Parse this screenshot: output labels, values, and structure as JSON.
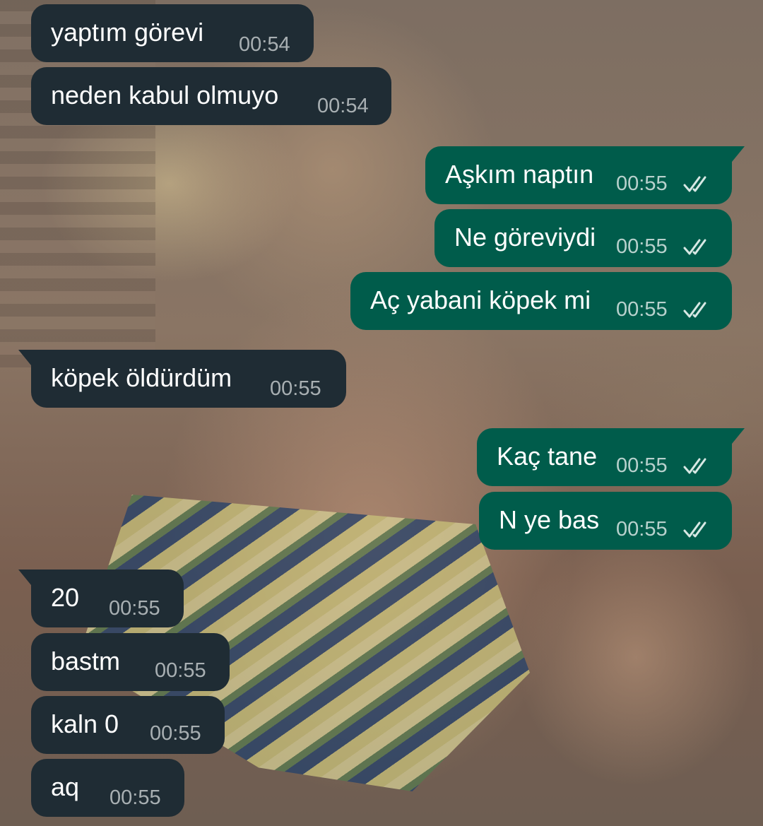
{
  "chat": {
    "messages": [
      {
        "direction": "incoming",
        "text": "yaptım görevi",
        "time": "00:54"
      },
      {
        "direction": "incoming",
        "text": "neden kabul olmuyo",
        "time": "00:54"
      },
      {
        "direction": "outgoing",
        "text": "Aşkım naptın",
        "time": "00:55",
        "status": "read-double-check"
      },
      {
        "direction": "outgoing",
        "text": "Ne göreviydi",
        "time": "00:55",
        "status": "read-double-check"
      },
      {
        "direction": "outgoing",
        "text": "Aç yabani köpek mi",
        "time": "00:55",
        "status": "read-double-check"
      },
      {
        "direction": "incoming",
        "text": "köpek öldürdüm",
        "time": "00:55"
      },
      {
        "direction": "outgoing",
        "text": "Kaç tane",
        "time": "00:55",
        "status": "read-double-check"
      },
      {
        "direction": "outgoing",
        "text": "N ye bas",
        "time": "00:55",
        "status": "read-double-check"
      },
      {
        "direction": "incoming",
        "text": "20",
        "time": "00:55"
      },
      {
        "direction": "incoming",
        "text": "bastm",
        "time": "00:55"
      },
      {
        "direction": "incoming",
        "text": "kaln 0",
        "time": "00:55"
      },
      {
        "direction": "incoming",
        "text": "aq",
        "time": "00:55"
      }
    ]
  },
  "colors": {
    "incoming_bubble": "#1f2c34",
    "outgoing_bubble": "#005c4b",
    "text": "#ffffff",
    "timestamp": "#e9edef"
  },
  "icons": {
    "read_receipt": "double-check-icon"
  }
}
